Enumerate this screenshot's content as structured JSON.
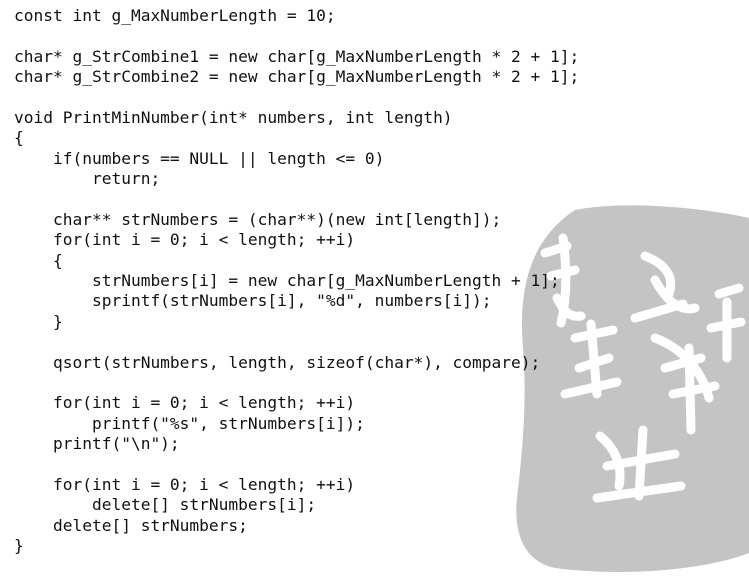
{
  "code_listing": {
    "lines": [
      "const int g_MaxNumberLength = 10;",
      "",
      "char* g_StrCombine1 = new char[g_MaxNumberLength * 2 + 1];",
      "char* g_StrCombine2 = new char[g_MaxNumberLength * 2 + 1];",
      "",
      "void PrintMinNumber(int* numbers, int length)",
      "{",
      "    if(numbers == NULL || length <= 0)",
      "        return;",
      "",
      "    char** strNumbers = (char**)(new int[length]);",
      "    for(int i = 0; i < length; ++i)",
      "    {",
      "        strNumbers[i] = new char[g_MaxNumberLength + 1];",
      "        sprintf(strNumbers[i], \"%d\", numbers[i]);",
      "    }",
      "",
      "    qsort(strNumbers, length, sizeof(char*), compare);",
      "",
      "    for(int i = 0; i < length; ++i)",
      "        printf(\"%s\", strNumbers[i]);",
      "    printf(\"\\n\");",
      "",
      "    for(int i = 0; i < length; ++i)",
      "        delete[] strNumbers[i];",
      "    delete[] strNumbers;",
      "}"
    ]
  },
  "watermark": {
    "icon": "seal-stamp-icon",
    "color": "#c4c4c4"
  }
}
